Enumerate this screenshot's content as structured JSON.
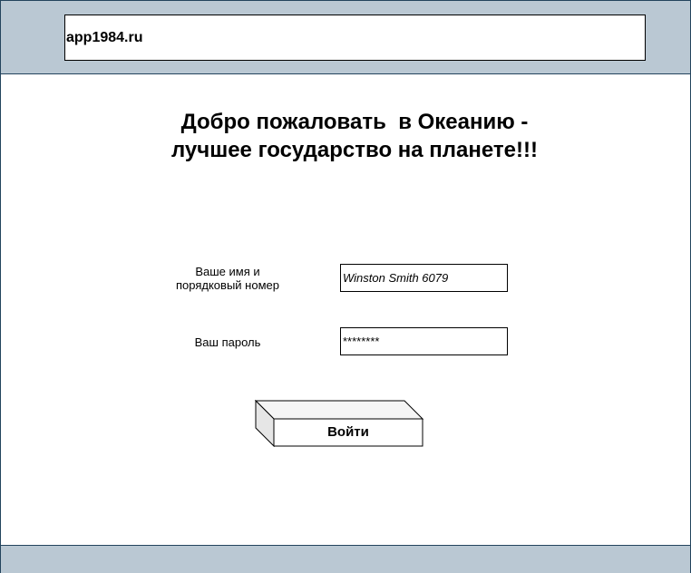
{
  "address_bar": {
    "url": "app1984.ru"
  },
  "welcome": {
    "line1": "Добро пожаловать  в Океанию -",
    "line2": "лучшее государство на планете!!!"
  },
  "form": {
    "name_label_line1": "Ваше имя и",
    "name_label_line2": "порядковый номер",
    "name_value": "Winston Smith 6079",
    "password_label": "Ваш пароль",
    "password_value": "********",
    "submit_label": "Войти"
  },
  "colors": {
    "bar_fill": "#bac8d3",
    "bar_border": "#23445d",
    "button_top": "#f5f5f5",
    "button_side": "#e6e6e6"
  }
}
